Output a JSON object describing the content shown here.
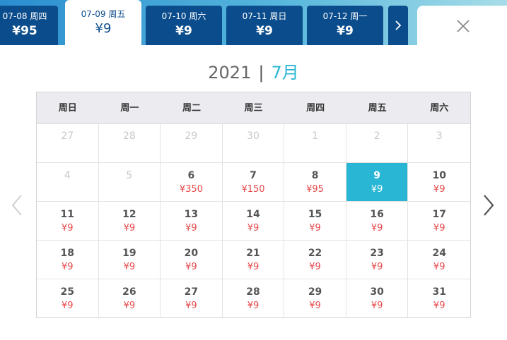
{
  "date_tabs": [
    {
      "date": "07-08 周四",
      "price": "¥95"
    },
    {
      "date": "07-09 周五",
      "price": "¥9"
    },
    {
      "date": "07-10 周六",
      "price": "¥9"
    },
    {
      "date": "07-11 周日",
      "price": "¥9"
    },
    {
      "date": "07-12 周一",
      "price": "¥9"
    }
  ],
  "active_tab_index": 1,
  "header": {
    "year": "2021",
    "separator": "|",
    "month": "7月"
  },
  "weekdays": [
    "周日",
    "周一",
    "周二",
    "周三",
    "周四",
    "周五",
    "周六"
  ],
  "days": [
    {
      "n": "27",
      "p": "",
      "muted": true
    },
    {
      "n": "28",
      "p": "",
      "muted": true
    },
    {
      "n": "29",
      "p": "",
      "muted": true
    },
    {
      "n": "30",
      "p": "",
      "muted": true
    },
    {
      "n": "1",
      "p": "",
      "muted": true
    },
    {
      "n": "2",
      "p": "",
      "muted": true
    },
    {
      "n": "3",
      "p": "",
      "muted": true
    },
    {
      "n": "4",
      "p": "",
      "muted": true
    },
    {
      "n": "5",
      "p": "",
      "muted": true
    },
    {
      "n": "6",
      "p": "¥350"
    },
    {
      "n": "7",
      "p": "¥150"
    },
    {
      "n": "8",
      "p": "¥95"
    },
    {
      "n": "9",
      "p": "¥9",
      "selected": true
    },
    {
      "n": "10",
      "p": "¥9"
    },
    {
      "n": "11",
      "p": "¥9"
    },
    {
      "n": "12",
      "p": "¥9"
    },
    {
      "n": "13",
      "p": "¥9"
    },
    {
      "n": "14",
      "p": "¥9"
    },
    {
      "n": "15",
      "p": "¥9"
    },
    {
      "n": "16",
      "p": "¥9"
    },
    {
      "n": "17",
      "p": "¥9"
    },
    {
      "n": "18",
      "p": "¥9"
    },
    {
      "n": "19",
      "p": "¥9"
    },
    {
      "n": "20",
      "p": "¥9"
    },
    {
      "n": "21",
      "p": "¥9"
    },
    {
      "n": "22",
      "p": "¥9"
    },
    {
      "n": "23",
      "p": "¥9"
    },
    {
      "n": "24",
      "p": "¥9"
    },
    {
      "n": "25",
      "p": "¥9"
    },
    {
      "n": "26",
      "p": "¥9"
    },
    {
      "n": "27",
      "p": "¥9"
    },
    {
      "n": "28",
      "p": "¥9"
    },
    {
      "n": "29",
      "p": "¥9"
    },
    {
      "n": "30",
      "p": "¥9"
    },
    {
      "n": "31",
      "p": "¥9"
    }
  ],
  "icons": {
    "close": "close-icon",
    "next_tabs": "chevron-right-icon",
    "prev_month": "chevron-left-icon",
    "next_month": "chevron-right-icon"
  },
  "colors": {
    "tab_bg": "#0b4d8c",
    "accent": "#29b6d4",
    "price": "#e8474a",
    "header_bg": "#ebebf0"
  }
}
